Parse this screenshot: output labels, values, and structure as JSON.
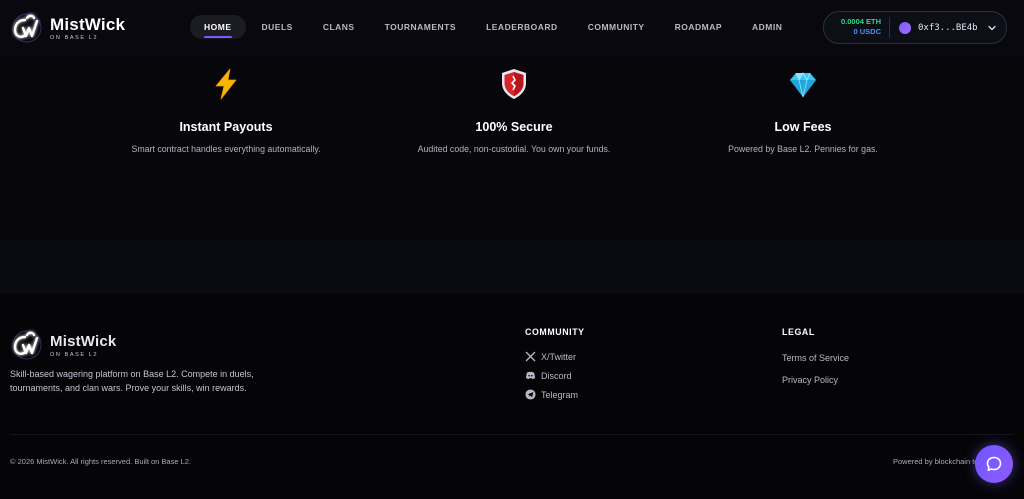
{
  "brand": {
    "name": "MistWick",
    "subtitle": "ON BASE L2"
  },
  "nav": {
    "items": [
      {
        "label": "HOME",
        "active": true
      },
      {
        "label": "DUELS"
      },
      {
        "label": "CLANS"
      },
      {
        "label": "TOURNAMENTS"
      },
      {
        "label": "LEADERBOARD"
      },
      {
        "label": "COMMUNITY"
      },
      {
        "label": "ROADMAP"
      },
      {
        "label": "ADMIN"
      }
    ]
  },
  "wallet": {
    "eth_balance": "0.0004 ETH",
    "usdc_balance": "0 USDC",
    "address": "0xf3...BE4b"
  },
  "features": [
    {
      "icon": "lightning-icon",
      "title": "Instant Payouts",
      "description": "Smart contract handles everything automatically."
    },
    {
      "icon": "shield-icon",
      "title": "100% Secure",
      "description": "Audited code, non-custodial. You own your funds."
    },
    {
      "icon": "diamond-icon",
      "title": "Low Fees",
      "description": "Powered by Base L2. Pennies for gas."
    }
  ],
  "footer": {
    "description": "Skill-based wagering platform on Base L2. Compete in duels, tournaments, and clan wars. Prove your skills, win rewards.",
    "community": {
      "title": "COMMUNITY",
      "links": [
        {
          "label": "X/Twitter",
          "icon": "x-icon"
        },
        {
          "label": "Discord",
          "icon": "discord-icon"
        },
        {
          "label": "Telegram",
          "icon": "telegram-icon"
        }
      ]
    },
    "legal": {
      "title": "LEGAL",
      "links": [
        {
          "label": "Terms of Service"
        },
        {
          "label": "Privacy Policy"
        }
      ]
    },
    "copyright": "© 2026 MistWick. All rights reserved. Built on Base L2.",
    "powered_by": "Powered by blockchain technology"
  },
  "colors": {
    "accent": "#7f56ff",
    "eth": "#35d48c",
    "usdc": "#4e8cff",
    "background": "#07070c"
  }
}
